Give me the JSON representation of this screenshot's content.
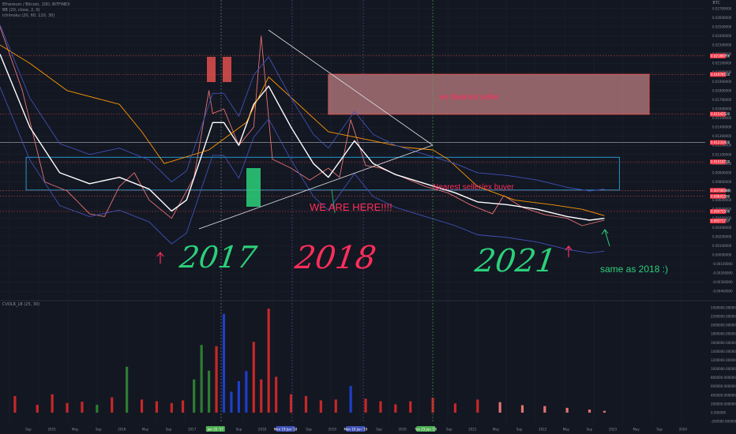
{
  "header": {
    "title": "Ethereum / Bitcoin, 10D, BITFINEX",
    "indicator_1": "BB (20, close, 2, 0)",
    "indicator_2": "Ichimoku (20, 60, 120, 30)",
    "price_unit": "BTC"
  },
  "sub_pane": {
    "title": "CVOLR_LB (25, 30)"
  },
  "annotations": {
    "handwritten_2017": "2017",
    "handwritten_2018": "2018",
    "handwritten_2021": "2021",
    "ex_nearest_seller": "ex Nearest seller",
    "nearest_seller_ex_buyer": "Nearest seller/ex buyer",
    "we_are_here": "WE ARE HERE!!!!",
    "same_as_2018": "same as 2018 :)"
  },
  "colors": {
    "background": "#131722",
    "grid": "#1e222d",
    "bb_band": "#3f51b5",
    "bb_basis": "#ffffff",
    "ichimoku_base": "#ff9800",
    "ichimoku_lead": "#e91e63",
    "up_candle": "#26a69a",
    "down_candle": "#ef5350",
    "volume_up": "#2e7d32",
    "volume_down": "#c62828",
    "volume_blue": "#1e3fc8",
    "resistance_zone": "#f7a3a3",
    "support_zone_border": "#29b6f6",
    "annotation_red": "#ff2e5a",
    "annotation_green": "#2bd07a",
    "trendline": "#e0e0e0"
  },
  "chart_data": [
    {
      "type": "line",
      "pane": "price",
      "ylabel": "BTC",
      "ylim": [
        -0.0045,
        0.0275
      ],
      "x_axis": [
        "Sep",
        "2015",
        "May",
        "Sep",
        "2016",
        "May",
        "Sep",
        "2017",
        "Jan 25 '17",
        "Sep",
        "2018",
        "Mon 19 Jun '18",
        "Sep",
        "2019",
        "Mon 10 Jun '19",
        "Sep",
        "2020",
        "Tue 23 Jun '20",
        "Sep",
        "2021",
        "May",
        "Sep",
        "2022",
        "May",
        "Sep",
        "2023",
        "May",
        "Sep",
        "2024"
      ],
      "y_ticks": [
        "0.02700000",
        "0.02600000",
        "0.02500000",
        "0.02400000",
        "0.02300000",
        "0.02200000",
        "0.02100000",
        "0.02000000",
        "0.01900000",
        "0.01800000",
        "0.01700000",
        "0.01600000",
        "0.01500000",
        "0.01400000",
        "0.01300000",
        "0.01200000",
        "0.01100000",
        "0.01000000",
        "0.00900000",
        "0.00800000",
        "0.00700000",
        "0.00600000",
        "0.00500000",
        "0.00400000",
        "0.00300000",
        "0.00200000",
        "0.00100000",
        "0.00000000",
        "-0.00100000",
        "-0.00200000",
        "-0.00300000",
        "-0.00400000"
      ],
      "price_labels": [
        {
          "value": 0.02180766,
          "text": "0.02180766"
        },
        {
          "value": 0.0197651,
          "text": "0.01976510"
        },
        {
          "value": 0.0154252,
          "text": "0.01542520"
        },
        {
          "value": 0.012314,
          "text": "0.01231400"
        },
        {
          "value": 0.0101872,
          "text": "0.01018720"
        },
        {
          "value": 0.0070644,
          "text": "0.00706440"
        },
        {
          "value": 0.0064138,
          "text": "0.00641380"
        },
        {
          "value": 0.004755,
          "text": "0.00475500"
        },
        {
          "value": 0.00371717,
          "text": "0.00371717"
        }
      ],
      "horizontal_levels": [
        0.02180766,
        0.0197651,
        0.0154252,
        0.012314,
        0.0101872,
        0.0070644,
        0.0064138,
        0.004755
      ],
      "zones": [
        {
          "label": "ex Nearest seller",
          "from_year": 2019.0,
          "to_year": 2023.3,
          "low": 0.0154,
          "high": 0.0198
        },
        {
          "label": "Nearest seller/ex buyer",
          "from_year": 2014.95,
          "to_year": 2022.9,
          "low": 0.0071,
          "high": 0.0107
        }
      ],
      "series": [
        {
          "name": "Ethereum / Bitcoin",
          "x": [
            2014.6,
            2014.9,
            2015.2,
            2015.5,
            2015.8,
            2016.0,
            2016.2,
            2016.4,
            2016.6,
            2016.9,
            2017.2,
            2017.4,
            2017.45,
            2017.6,
            2017.8,
            2018.0,
            2018.1,
            2018.25,
            2018.5,
            2018.75,
            2019.0,
            2019.15,
            2019.3,
            2019.5,
            2019.7,
            2020.0,
            2020.3,
            2020.6,
            2020.9,
            2021.2,
            2021.35,
            2021.6,
            2021.9,
            2022.2,
            2022.4,
            2022.55,
            2022.7
          ],
          "y": [
            0.025,
            0.018,
            0.008,
            0.007,
            0.0045,
            0.0042,
            0.0075,
            0.009,
            0.006,
            0.004,
            0.0085,
            0.018,
            0.0155,
            0.016,
            0.012,
            0.014,
            0.024,
            0.0105,
            0.0095,
            0.0082,
            0.0095,
            0.0085,
            0.0148,
            0.0098,
            0.0095,
            0.0085,
            0.0075,
            0.0068,
            0.0055,
            0.0045,
            0.0065,
            0.0052,
            0.0044,
            0.004,
            0.0032,
            0.0035,
            0.0038
          ]
        },
        {
          "name": "BB basis",
          "x": [
            2014.6,
            2015.0,
            2015.4,
            2015.8,
            2016.2,
            2016.6,
            2016.9,
            2017.1,
            2017.45,
            2017.6,
            2017.8,
            2018.0,
            2018.2,
            2018.5,
            2018.8,
            2019.0,
            2019.35,
            2019.6,
            2019.9,
            2020.3,
            2020.7,
            2021.0,
            2021.4,
            2021.8,
            2022.2,
            2022.5,
            2022.7
          ],
          "y": [
            0.022,
            0.014,
            0.009,
            0.0078,
            0.0085,
            0.0072,
            0.0048,
            0.006,
            0.0145,
            0.0145,
            0.012,
            0.0165,
            0.0185,
            0.014,
            0.01,
            0.0085,
            0.0125,
            0.01,
            0.0088,
            0.0078,
            0.0068,
            0.0058,
            0.0055,
            0.005,
            0.0042,
            0.0038,
            0.004
          ]
        },
        {
          "name": "Ichimoku base",
          "x": [
            2014.6,
            2015.0,
            2015.5,
            2016.2,
            2016.5,
            2016.8,
            2017.4,
            2017.9,
            2018.2,
            2018.6,
            2019.0,
            2019.6,
            2020.0,
            2020.4,
            2020.6,
            2021.0,
            2021.5,
            2022.0,
            2022.4,
            2022.7
          ],
          "y": [
            0.023,
            0.021,
            0.018,
            0.0165,
            0.0135,
            0.01,
            0.0115,
            0.0145,
            0.0195,
            0.0165,
            0.0135,
            0.0125,
            0.0118,
            0.0115,
            0.0105,
            0.0075,
            0.006,
            0.0055,
            0.005,
            0.0043
          ]
        }
      ]
    },
    {
      "type": "bar",
      "pane": "volume",
      "title": "CVOLR_LB (25, 30)",
      "ylim": [
        -200000,
        2400000
      ],
      "y_ticks": [
        "2400000.000000",
        "2200000.000000",
        "2000000.000000",
        "1800000.000000",
        "1600000.000000",
        "1400000.000000",
        "1200000.000000",
        "1000000.000000",
        "800000.000000",
        "600000.000000",
        "400000.000000",
        "200000.000000",
        "0.000000",
        "-200000.000000"
      ],
      "x": [
        2014.8,
        2015.1,
        2015.3,
        2015.5,
        2015.7,
        2015.9,
        2016.1,
        2016.3,
        2016.5,
        2016.7,
        2016.9,
        2017.05,
        2017.2,
        2017.3,
        2017.4,
        2017.5,
        2017.6,
        2017.7,
        2017.8,
        2017.9,
        2018.0,
        2018.1,
        2018.2,
        2018.3,
        2018.5,
        2018.7,
        2018.9,
        2019.1,
        2019.3,
        2019.5,
        2019.7,
        2019.9,
        2020.1,
        2020.4,
        2020.7,
        2021.0,
        2021.3,
        2021.6,
        2021.9,
        2022.2,
        2022.5,
        2022.7
      ],
      "values": [
        380000,
        180000,
        420000,
        220000,
        250000,
        180000,
        350000,
        1050000,
        300000,
        260000,
        220000,
        280000,
        760000,
        1550000,
        960000,
        1520000,
        2260000,
        480000,
        720000,
        950000,
        1620000,
        760000,
        2380000,
        820000,
        420000,
        380000,
        280000,
        300000,
        610000,
        320000,
        260000,
        190000,
        260000,
        340000,
        210000,
        300000,
        240000,
        170000,
        150000,
        110000,
        70000,
        40000
      ]
    }
  ]
}
